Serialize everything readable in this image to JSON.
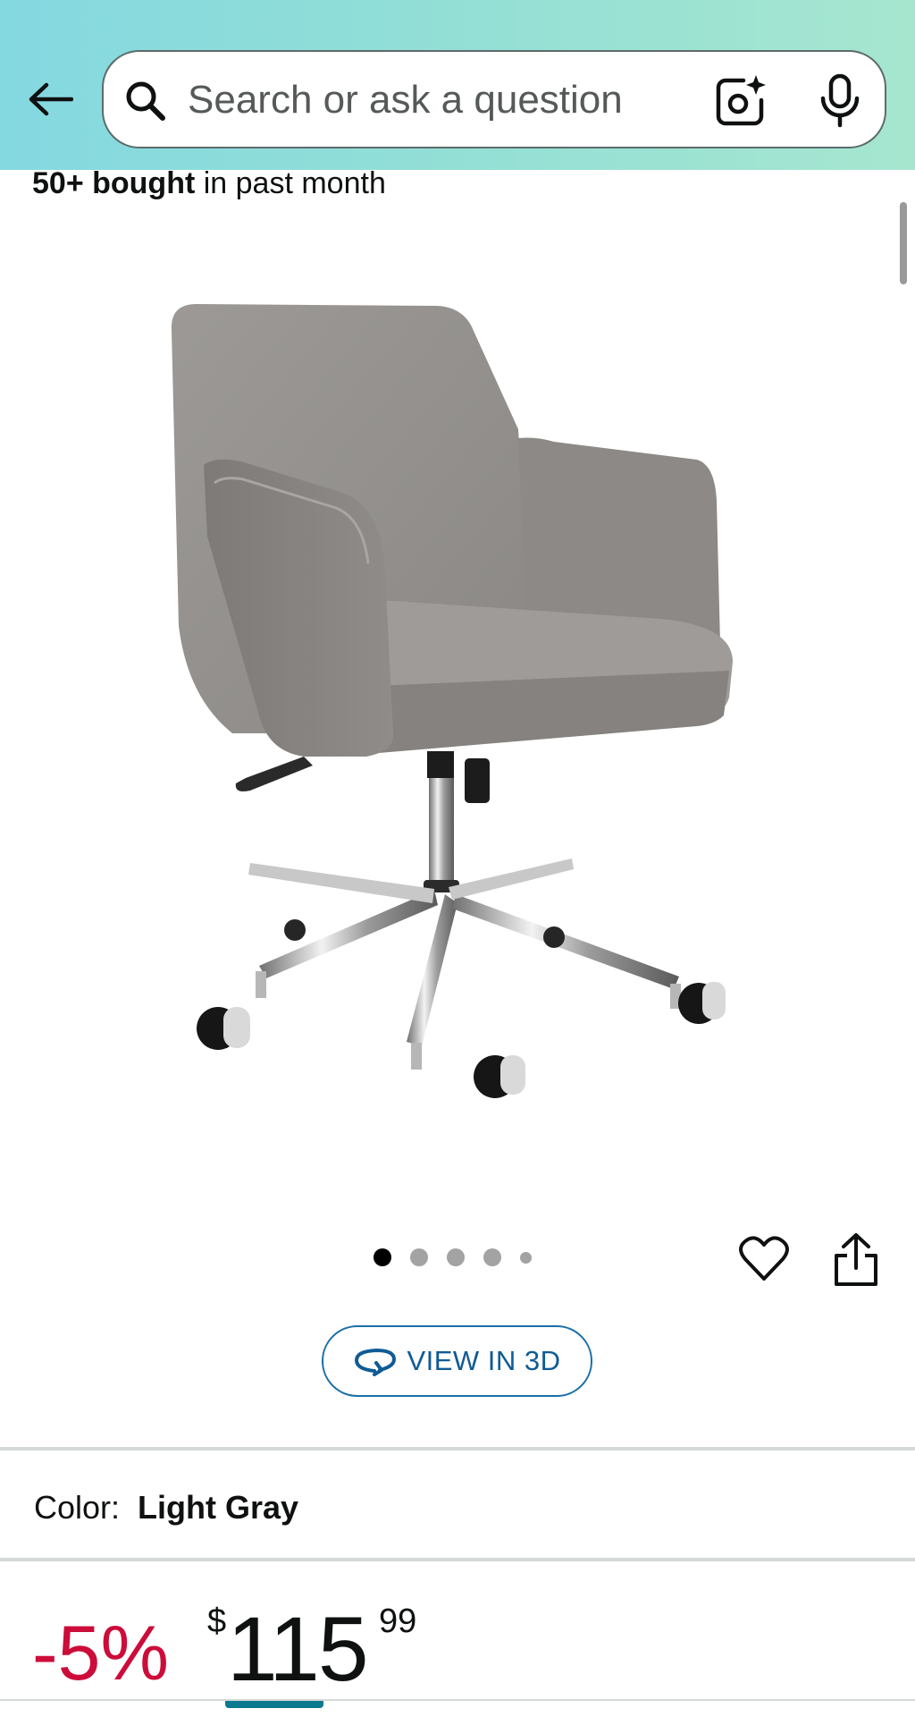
{
  "search": {
    "placeholder": "Search or ask a question"
  },
  "icons": {
    "back": "arrow-left-icon",
    "search": "magnifier-icon",
    "lens": "camera-sparkle-icon",
    "mic": "microphone-icon",
    "heart": "heart-outline-icon",
    "share": "share-icon",
    "view3d": "rotate-3d-icon"
  },
  "product": {
    "bought_count": "50+ bought",
    "bought_suffix": " in past month",
    "image_alt": "Light gray upholstered office chair with chrome base"
  },
  "gallery": {
    "total_images": 5,
    "active_index": 0
  },
  "view3d": {
    "label": "VIEW IN 3D"
  },
  "variant": {
    "label": "Color:",
    "value": "Light Gray"
  },
  "price": {
    "discount": "-5%",
    "currency_symbol": "$",
    "whole": "115",
    "fraction": "99"
  },
  "colors": {
    "header_gradient_start": "#84d8e0",
    "header_gradient_end": "#a6e6cf",
    "discount_red": "#cc0c39",
    "link_blue": "#0f5b95",
    "accent_teal": "#0b7a8f"
  }
}
